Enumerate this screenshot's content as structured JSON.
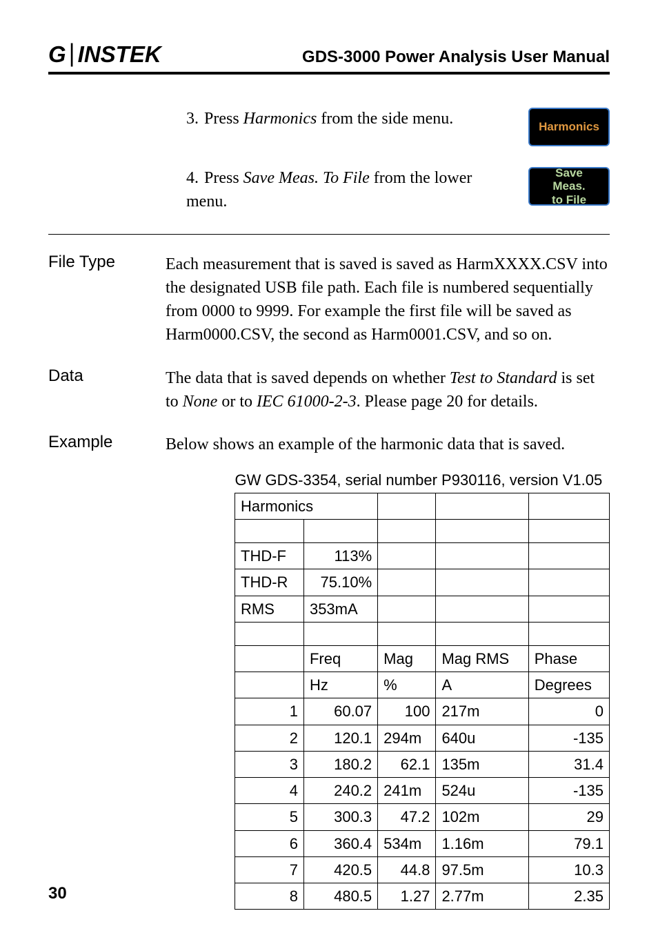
{
  "header": {
    "logo_text": "GWINSTEK",
    "title": "GDS-3000 Power Analysis User Manual"
  },
  "steps": [
    {
      "num": "3.",
      "pre": "Press ",
      "italic": "Harmonics",
      "post": " from the side menu.",
      "button": "Harmonics",
      "button_class": "orange"
    },
    {
      "num": "4.",
      "pre": "Press ",
      "italic": "Save Meas. To File",
      "post": " from the lower menu.",
      "button": "Save\nMeas.\nto File",
      "button_class": ""
    }
  ],
  "sections": {
    "file_type": {
      "label": "File Type",
      "body": "Each measurement that is saved is saved as HarmXXXX.CSV into the designated USB file path. Each file is numbered sequentially from 0000 to 9999. For example the first file will be saved as Harm0000.CSV, the second as Harm0001.CSV, and so on."
    },
    "data": {
      "label": "Data",
      "pre": " The data that is saved depends on whether ",
      "italic1": "Test to Standard",
      "mid": " is set to ",
      "italic2": "None",
      "mid2": " or to ",
      "italic3": "IEC 61000-2-3",
      "post": ". Please page 20 for details."
    },
    "example": {
      "label": "Example",
      "body": "Below shows an example of the harmonic data that is saved."
    }
  },
  "table": {
    "device_info": "GW GDS-3354, serial number P930116, version V1.05",
    "section_title": "Harmonics",
    "summary": [
      {
        "label": "THD-F",
        "value": "113%"
      },
      {
        "label": "THD-R",
        "value": "75.10%"
      },
      {
        "label": "RMS",
        "value": "353mA"
      }
    ],
    "headers1": [
      "",
      "Freq",
      "Mag",
      "Mag RMS",
      "Phase"
    ],
    "headers2": [
      "",
      "Hz",
      "%",
      "A",
      "Degrees"
    ],
    "rows": [
      {
        "n": "1",
        "freq": "60.07",
        "mag": "100",
        "magrms": "217m",
        "phase": "0"
      },
      {
        "n": "2",
        "freq": "120.1",
        "mag": "294m",
        "magrms": "640u",
        "phase": "-135"
      },
      {
        "n": "3",
        "freq": "180.2",
        "mag": "62.1",
        "magrms": "135m",
        "phase": "31.4"
      },
      {
        "n": "4",
        "freq": "240.2",
        "mag": "241m",
        "magrms": "524u",
        "phase": "-135"
      },
      {
        "n": "5",
        "freq": "300.3",
        "mag": "47.2",
        "magrms": "102m",
        "phase": "29"
      },
      {
        "n": "6",
        "freq": "360.4",
        "mag": "534m",
        "magrms": "1.16m",
        "phase": "79.1"
      },
      {
        "n": "7",
        "freq": "420.5",
        "mag": "44.8",
        "magrms": "97.5m",
        "phase": "10.3"
      },
      {
        "n": "8",
        "freq": "480.5",
        "mag": "1.27",
        "magrms": "2.77m",
        "phase": "2.35"
      }
    ]
  },
  "page_number": "30"
}
